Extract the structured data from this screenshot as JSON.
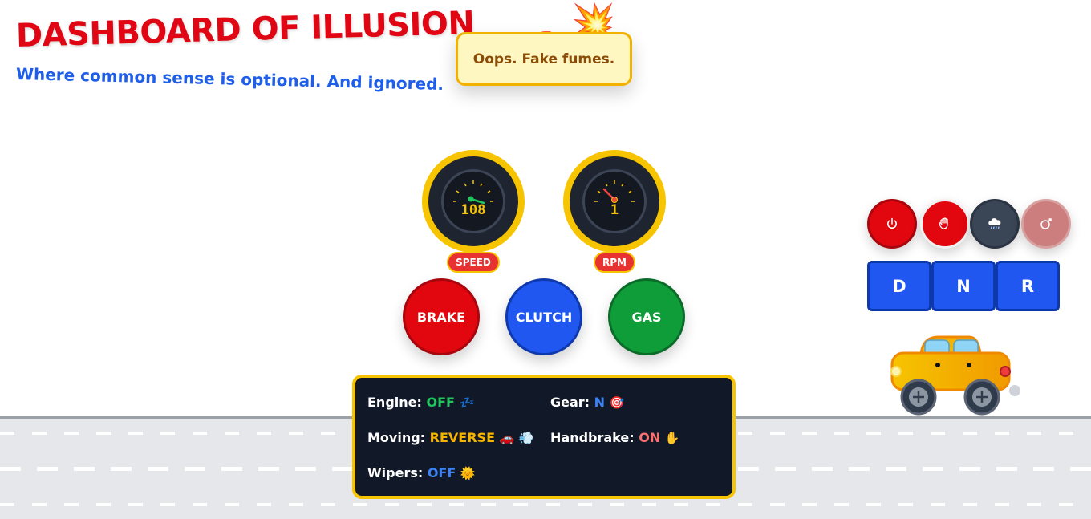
{
  "header": {
    "title": "DASHBOARD OF ILLUSION",
    "subtitle": "Where common sense is optional. And ignored.",
    "title_icons": [
      "car-emoji",
      "explosion-emoji"
    ]
  },
  "toast": {
    "message": "Oops. Fake fumes."
  },
  "gauges": {
    "speed": {
      "value": "108",
      "label": "SPEED"
    },
    "rpm": {
      "value": "1",
      "label": "RPM"
    }
  },
  "pedals": {
    "brake": "BRAKE",
    "clutch": "CLUTCH",
    "gas": "GAS"
  },
  "status": {
    "engine": {
      "label": "Engine:",
      "value": "OFF",
      "emoji": "💤"
    },
    "gear": {
      "label": "Gear:",
      "value": "N",
      "emoji": "🎯"
    },
    "moving": {
      "label": "Moving:",
      "value": "REVERSE",
      "emoji": "🚗 💨"
    },
    "handbrake": {
      "label": "Handbrake:",
      "value": "ON",
      "emoji": "✋"
    },
    "wipers": {
      "label": "Wipers:",
      "value": "OFF",
      "emoji": "🌞"
    }
  },
  "controls": {
    "icons": [
      "power-icon",
      "hand-icon",
      "rain-cloud-icon",
      "horn-icon"
    ]
  },
  "gears": {
    "d": "D",
    "n": "N",
    "r": "R"
  },
  "colors": {
    "title_red": "#e10613",
    "subtitle_blue": "#1e5ee8",
    "accent_yellow": "#f6c400",
    "panel_dark": "#111827",
    "brake_red": "#e2060f",
    "clutch_blue": "#1f57f0",
    "gas_green": "#0f9d3a"
  }
}
